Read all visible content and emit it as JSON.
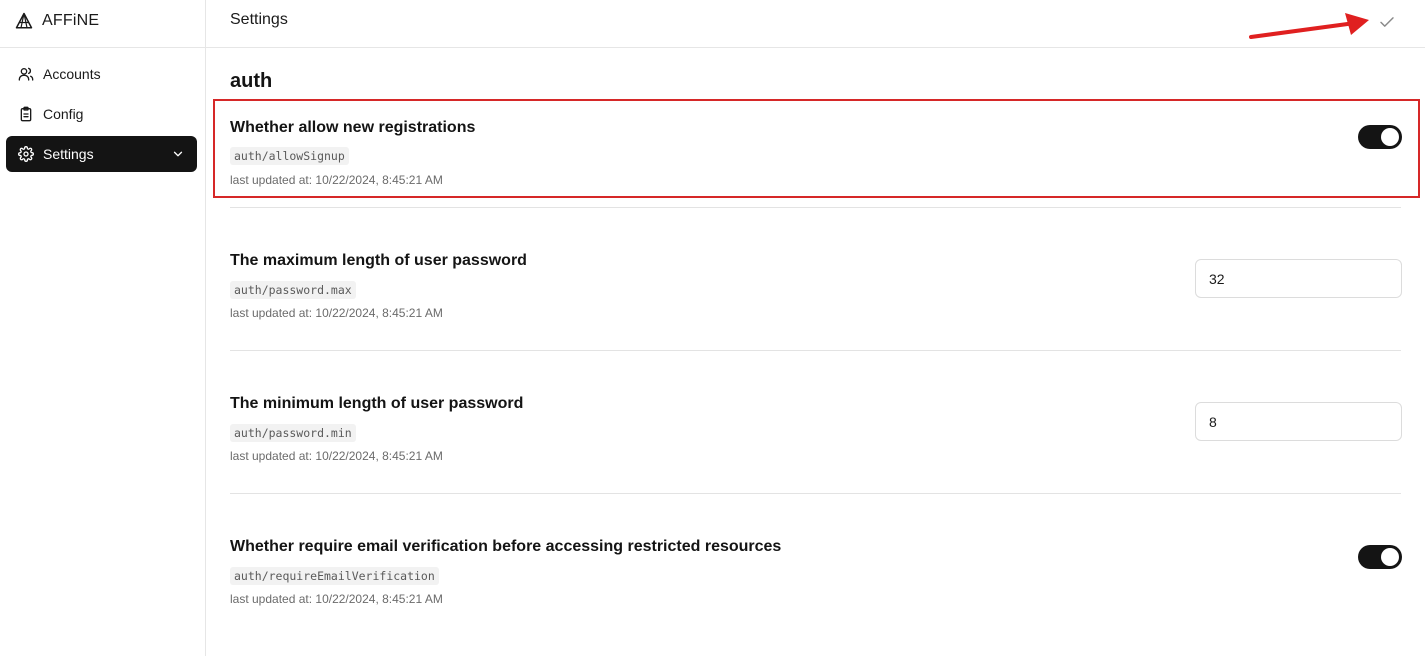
{
  "brand": {
    "name": "AFFiNE",
    "logo_icon": "affine-logo-icon"
  },
  "sidebar": {
    "items": [
      {
        "label": "Accounts",
        "icon": "users-icon",
        "active": false
      },
      {
        "label": "Config",
        "icon": "clipboard-icon",
        "active": false
      },
      {
        "label": "Settings",
        "icon": "gear-icon",
        "active": true,
        "expand_icon": "chevron-down-icon"
      }
    ]
  },
  "header": {
    "title": "Settings",
    "confirm_icon": "check-icon"
  },
  "main": {
    "section_title": "auth",
    "settings": [
      {
        "title": "Whether allow new registrations",
        "key": "auth/allowSignup",
        "updated": "last updated at: 10/22/2024, 8:45:21 AM",
        "control": "toggle",
        "value": true
      },
      {
        "title": "The maximum length of user password",
        "key": "auth/password.max",
        "updated": "last updated at: 10/22/2024, 8:45:21 AM",
        "control": "number",
        "value": "32"
      },
      {
        "title": "The minimum length of user password",
        "key": "auth/password.min",
        "updated": "last updated at: 10/22/2024, 8:45:21 AM",
        "control": "number",
        "value": "8"
      },
      {
        "title": "Whether require email verification before accessing restricted resources",
        "key": "auth/requireEmailVerification",
        "updated": "last updated at: 10/22/2024, 8:45:21 AM",
        "control": "toggle",
        "value": true
      }
    ]
  },
  "colors": {
    "active_nav_bg": "#141414",
    "toggle_on": "#141414",
    "annotation": "#d62828",
    "border": "#e6e6e6"
  }
}
